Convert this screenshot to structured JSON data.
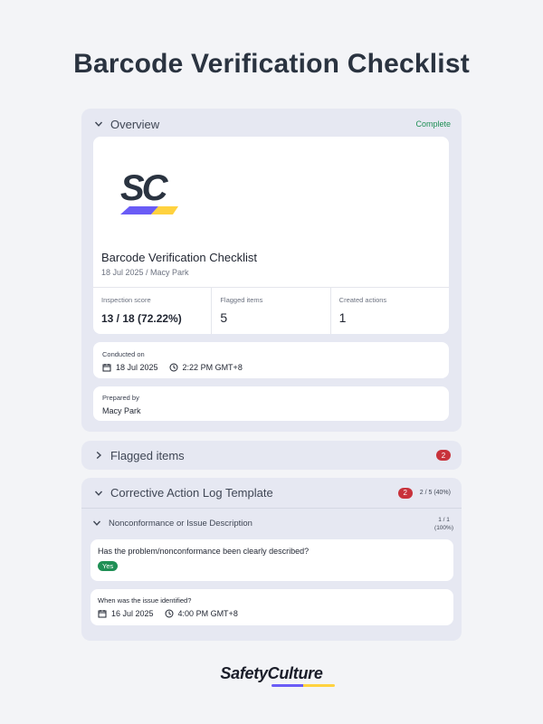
{
  "page": {
    "title": "Barcode Verification Checklist"
  },
  "overview": {
    "header": "Overview",
    "status": "Complete",
    "logo_text": "SC",
    "title": "Barcode Verification Checklist",
    "subtitle": "18 Jul 2025 / Macy Park",
    "stats": [
      {
        "label": "Inspection score",
        "value": "13 / 18 (72.22%)"
      },
      {
        "label": "Flagged items",
        "value": "5"
      },
      {
        "label": "Created actions",
        "value": "1"
      }
    ],
    "conducted": {
      "label": "Conducted on",
      "date": "18 Jul 2025",
      "time": "2:22 PM GMT+8"
    },
    "prepared": {
      "label": "Prepared by",
      "value": "Macy Park"
    }
  },
  "flagged": {
    "header": "Flagged items",
    "count": "2"
  },
  "corrective": {
    "header": "Corrective Action Log Template",
    "count": "2",
    "progress": "2 / 5 (40%)",
    "section": {
      "title": "Nonconformance or Issue Description",
      "progress_fraction": "1 / 1",
      "progress_percent": "(100%)"
    },
    "q1": {
      "text": "Has the problem/nonconformance been clearly described?",
      "answer": "Yes"
    },
    "q2": {
      "label": "When was the issue identified?",
      "date": "16 Jul 2025",
      "time": "4:00 PM GMT+8"
    }
  },
  "brand": {
    "name": "SafetyCulture"
  },
  "colors": {
    "accent_green": "#1f8f55",
    "flag_red": "#c8323b",
    "brand_purple": "#6a5cf6",
    "brand_yellow": "#ffd23f"
  }
}
